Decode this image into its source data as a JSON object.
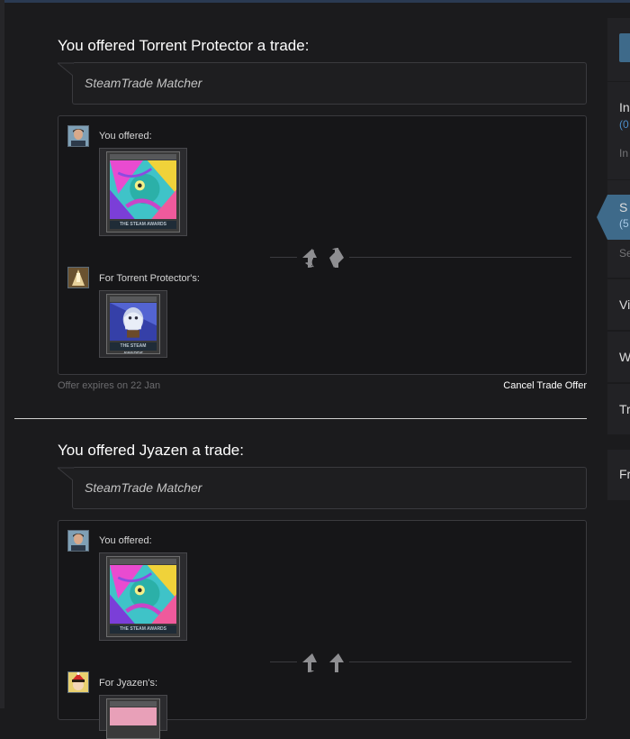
{
  "offers": [
    {
      "title": "You offered Torrent Protector a trade:",
      "message": "SteamTrade Matcher",
      "you_offered_label": "You offered:",
      "partner_label": "For Torrent Protector's:",
      "your_card_footer": "THE STEAM AWARDS",
      "partner_card_footer": "THE STEAM AWARDS",
      "expires": "Offer expires on 22 Jan",
      "cancel_label": "Cancel Trade Offer"
    },
    {
      "title": "You offered Jyazen a trade:",
      "message": "SteamTrade Matcher",
      "you_offered_label": "You offered:",
      "partner_label": "For Jyazen's:",
      "your_card_footer": "THE STEAM AWARDS"
    }
  ],
  "sidebar": {
    "items": [
      {
        "label": "In",
        "sub": "(0",
        "extra": "In"
      },
      {
        "label": "S",
        "sub": "(5",
        "extra": "Se",
        "active": true
      },
      {
        "label": "Vi"
      },
      {
        "label": "W"
      },
      {
        "label": "Tr"
      },
      {
        "label": "Fr"
      }
    ]
  },
  "colors": {
    "background": "#1b1b1d",
    "panel": "#161618",
    "accent_blue": "#4b8dc9",
    "active_tab": "#3e6a8a"
  },
  "icons": {
    "arrows": "trade-arrows-icon"
  }
}
